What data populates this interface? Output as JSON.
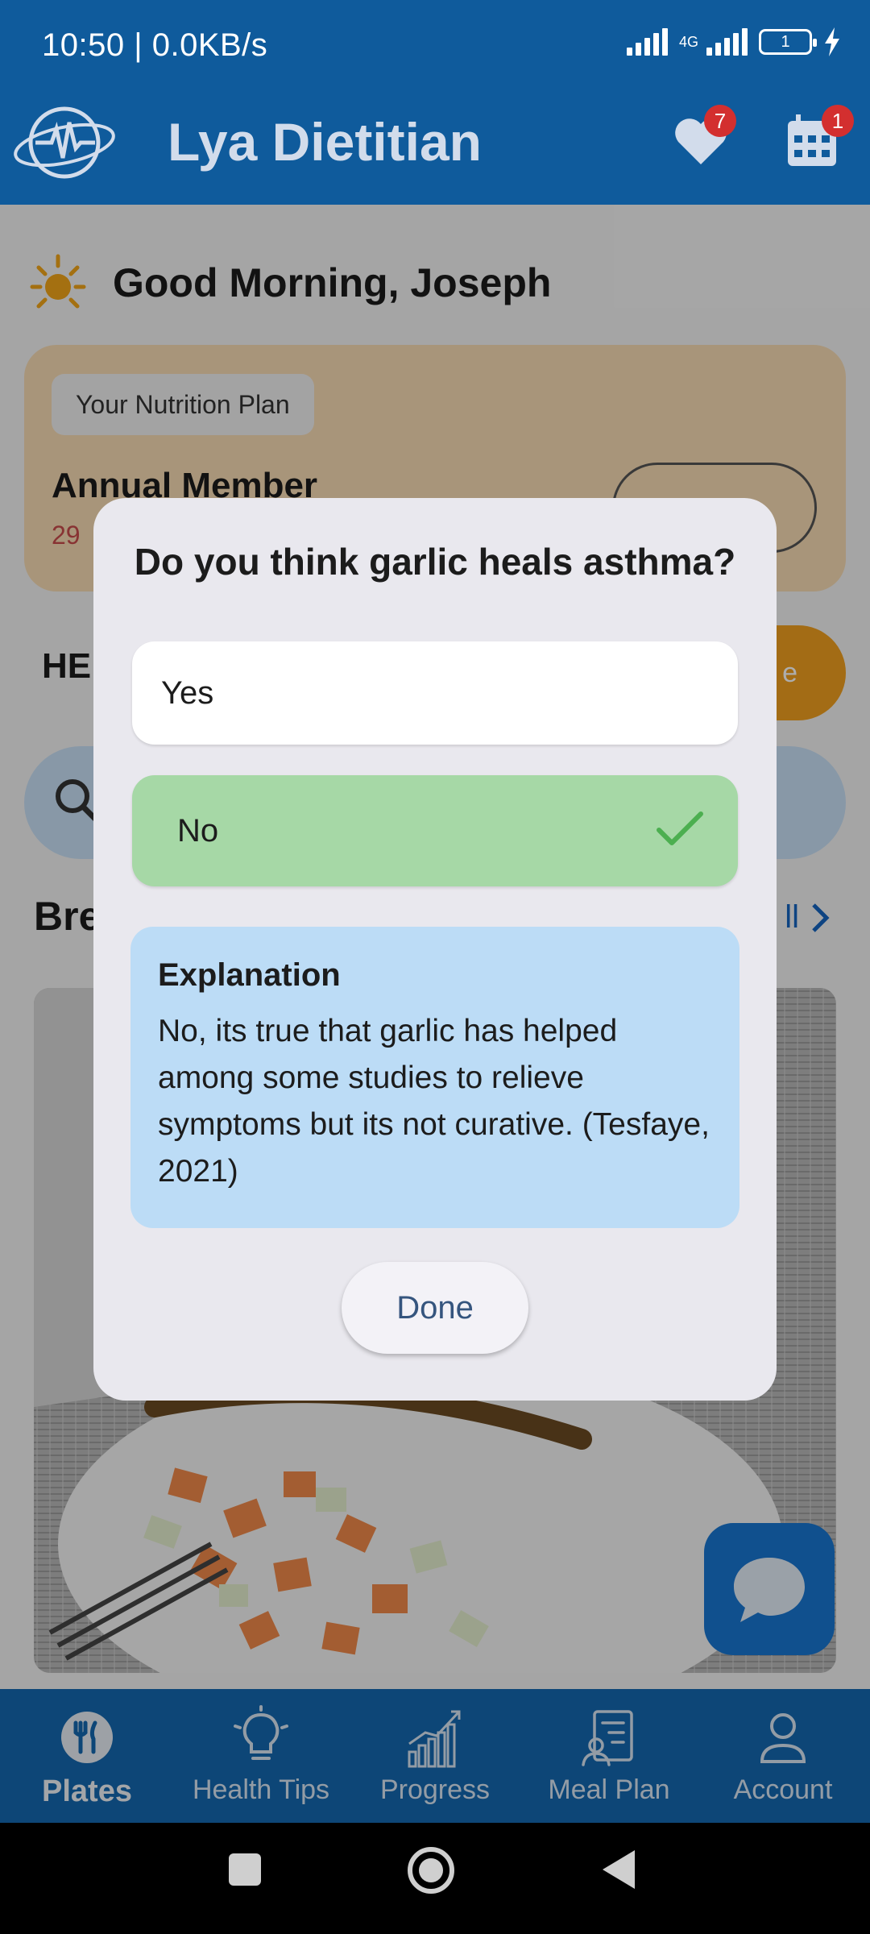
{
  "status_bar": {
    "time": "10:50 | 0.0KB/s",
    "network": "4G",
    "battery": "1"
  },
  "header": {
    "title": "Lya Dietitian",
    "favorites_badge": "7",
    "calendar_badge": "1",
    "brand_color": "#0f5b9c"
  },
  "home": {
    "greeting": "Good Morning, Joseph",
    "plan_chip": "Your Nutrition Plan",
    "plan_name": "Annual Member",
    "plan_days": "29",
    "section_partial": "HE",
    "orange_button_partial": "e",
    "breakfast_partial": "Bre",
    "see_all_partial": "ll"
  },
  "dialog": {
    "question": "Do you think garlic heals asthma?",
    "options": [
      {
        "label": "Yes",
        "selected": false
      },
      {
        "label": "No",
        "selected": true
      }
    ],
    "explanation_title": "Explanation",
    "explanation_text": "No, its true that garlic has helped among some studies to relieve symptoms but its not curative. (Tesfaye, 2021)",
    "done_label": "Done",
    "correct_color": "#a6d8a6",
    "explanation_color": "#bcdcf6"
  },
  "bottom_nav": {
    "items": [
      {
        "label": "Plates",
        "icon": "fork-knife-icon",
        "active": true
      },
      {
        "label": "Health Tips",
        "icon": "lightbulb-icon",
        "active": false
      },
      {
        "label": "Progress",
        "icon": "chart-icon",
        "active": false
      },
      {
        "label": "Meal Plan",
        "icon": "clipboard-icon",
        "active": false
      },
      {
        "label": "Account",
        "icon": "user-icon",
        "active": false
      }
    ]
  }
}
